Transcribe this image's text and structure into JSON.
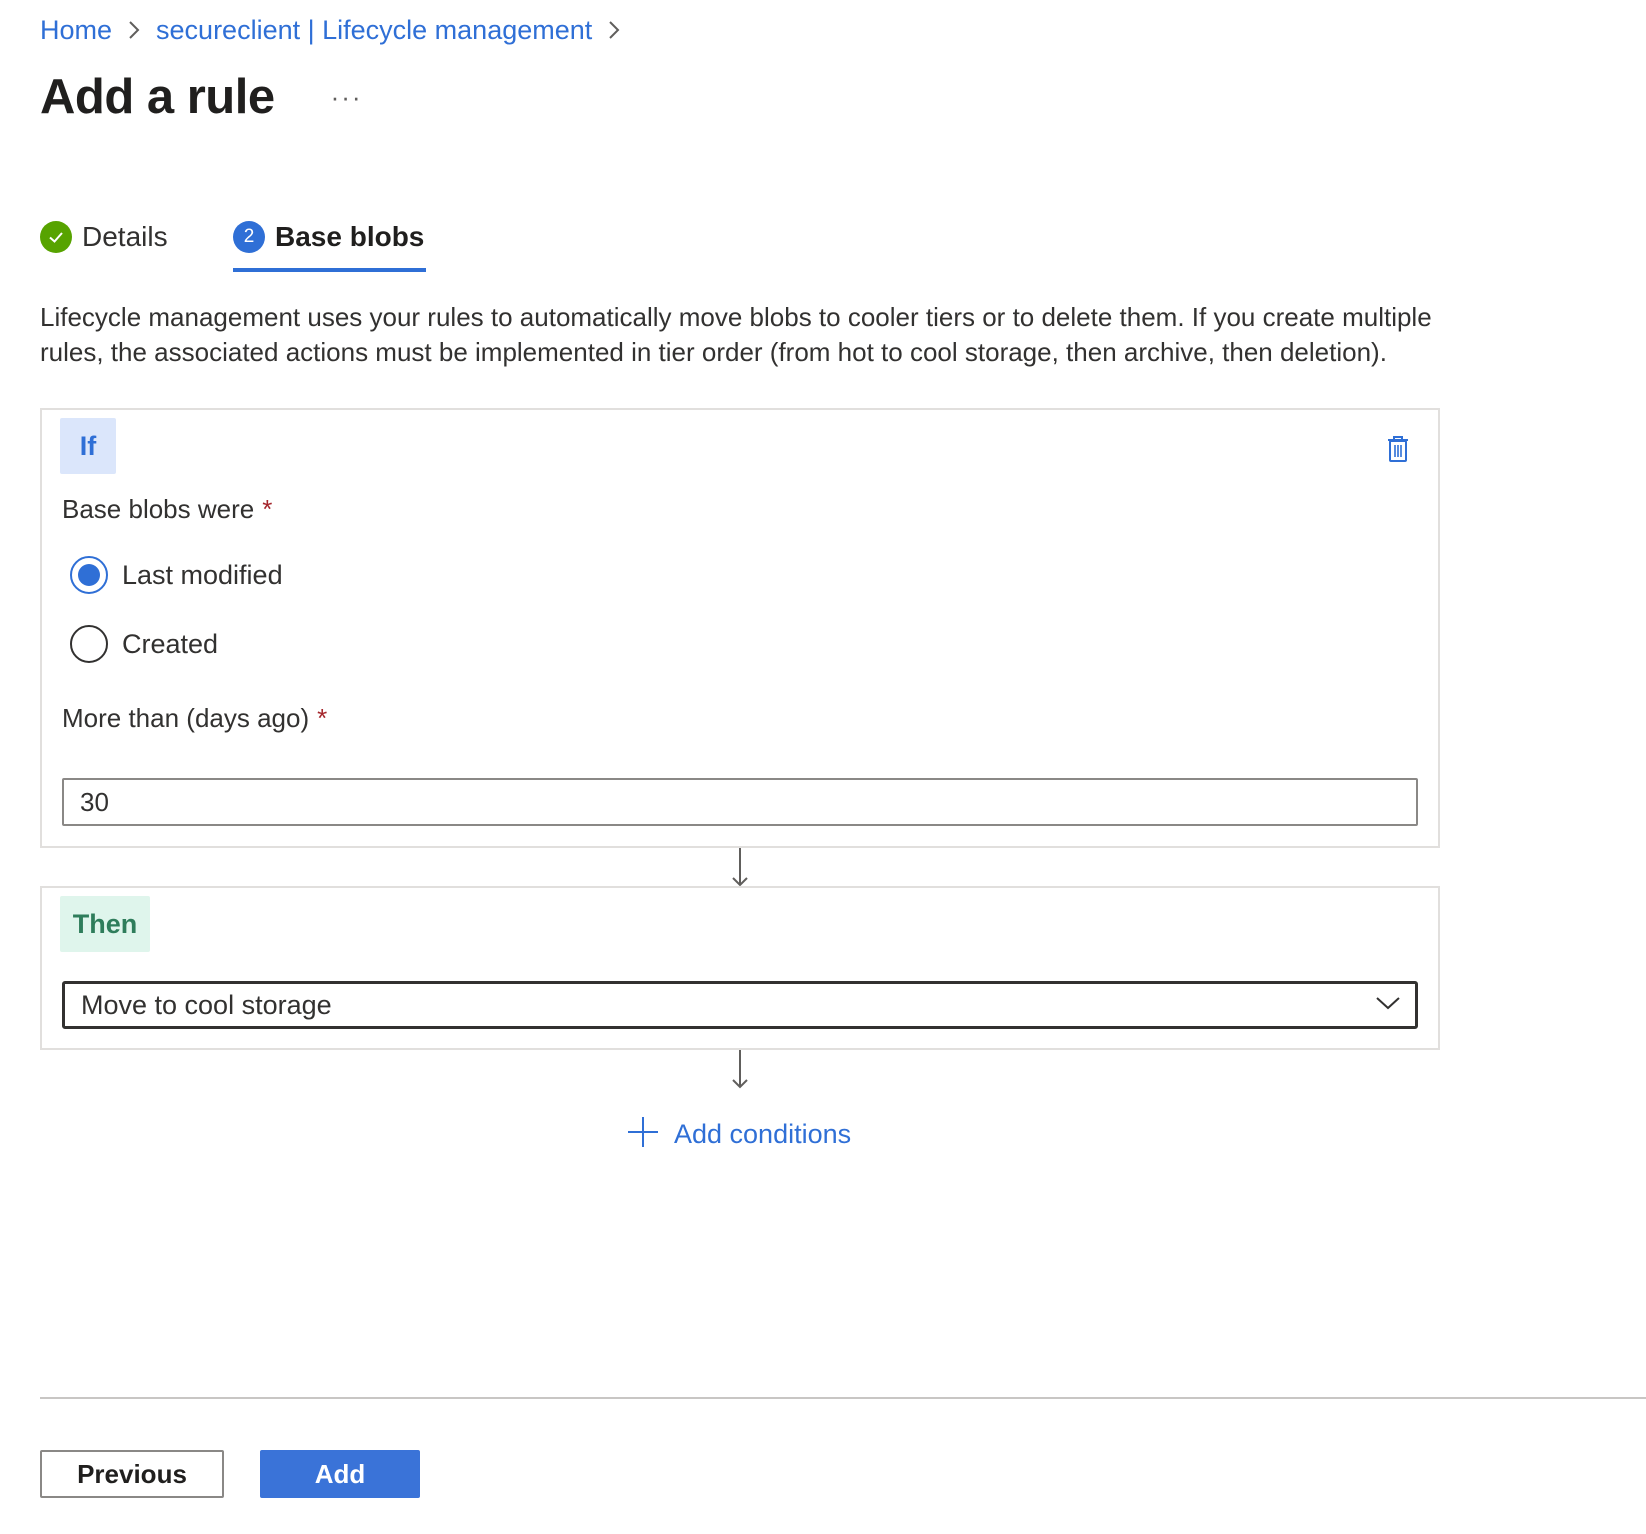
{
  "breadcrumb": {
    "items": [
      "Home",
      "secureclient | Lifecycle management"
    ]
  },
  "header": {
    "title": "Add a rule",
    "more_label": "···"
  },
  "tabs": [
    {
      "label": "Details",
      "state": "completed"
    },
    {
      "label": "Base blobs",
      "step_number": "2",
      "state": "active"
    }
  ],
  "description": "Lifecycle management uses your rules to automatically move blobs to cooler tiers or to delete them. If you create multiple rules, the associated actions must be implemented in tier order (from hot to cool storage, then archive, then deletion).",
  "if_block": {
    "pill_label": "If",
    "base_blobs_label": "Base blobs were",
    "required_marker": "*",
    "radio_options": [
      {
        "label": "Last modified",
        "checked": true
      },
      {
        "label": "Created",
        "checked": false
      }
    ],
    "days_label": "More than (days ago)",
    "days_value": "30"
  },
  "then_block": {
    "pill_label": "Then",
    "action_selected": "Move to cool storage"
  },
  "add_conditions_label": "Add conditions",
  "footer": {
    "previous_label": "Previous",
    "add_label": "Add"
  },
  "colors": {
    "accent": "#2f6fd6",
    "success": "#57a300",
    "if_pill_bg": "#dbe6fb",
    "then_pill_bg": "#dff5ec",
    "required": "#a4262c"
  },
  "icons": {
    "breadcrumb_separator": "chevron-right-icon",
    "completed_step": "checkmark-icon",
    "delete": "trash-icon",
    "dropdown": "chevron-down-icon",
    "flow": "arrow-down-icon",
    "add": "plus-icon"
  }
}
